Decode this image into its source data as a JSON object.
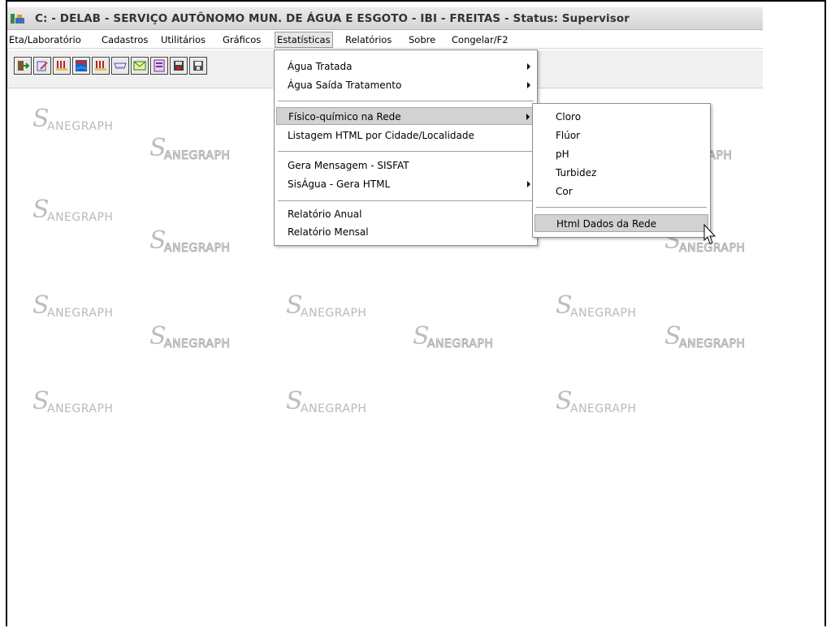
{
  "window": {
    "title": "C: - DELAB - SERVIÇO AUTÔNOMO MUN. DE ÁGUA E ESGOTO - IBI - FREITAS -   Status: Supervisor"
  },
  "menubar": {
    "items": [
      {
        "label": "Eta/Laboratório"
      },
      {
        "label": "Cadastros"
      },
      {
        "label": "Utilitários"
      },
      {
        "label": "Gráficos"
      },
      {
        "label": "Estatísticas"
      },
      {
        "label": "Relatórios"
      },
      {
        "label": "Sobre"
      },
      {
        "label": "Congelar/F2"
      }
    ],
    "active": "Estatísticas"
  },
  "toolbar": {
    "icons": [
      "exit-icon",
      "edit-icon",
      "chart-icon",
      "flow-icon",
      "chart-icon",
      "printer-icon",
      "email-icon",
      "list-icon",
      "disk-icon",
      "save-icon"
    ]
  },
  "statistics_menu": {
    "items": [
      {
        "label": "Água Tratada",
        "submenu": true
      },
      {
        "label": "Água Saída Tratamento",
        "submenu": true
      },
      {
        "label": "Físico-químico na Rede",
        "submenu": true,
        "highlighted": true
      },
      {
        "label": "Listagem HTML por Cidade/Localidade",
        "submenu": false
      },
      {
        "label": "Gera Mensagem - SISFAT",
        "submenu": false
      },
      {
        "label": "SisÁgua - Gera HTML",
        "submenu": true
      },
      {
        "label": "Relatório Anual",
        "submenu": false
      },
      {
        "label": "Relatório Mensal",
        "submenu": false
      }
    ]
  },
  "network_submenu": {
    "items": [
      {
        "label": "Cloro"
      },
      {
        "label": "Flúor"
      },
      {
        "label": "pH"
      },
      {
        "label": "Turbidez"
      },
      {
        "label": "Cor"
      },
      {
        "label": "Html Dados da Rede",
        "highlighted": true
      }
    ]
  },
  "watermark": {
    "text": "ANEGRAPH",
    "swoosh": "S"
  },
  "colors": {
    "menu_highlight": "#d2d2d2",
    "watermark": "#b9b9b9",
    "titlebar": "#dcdcdc"
  }
}
